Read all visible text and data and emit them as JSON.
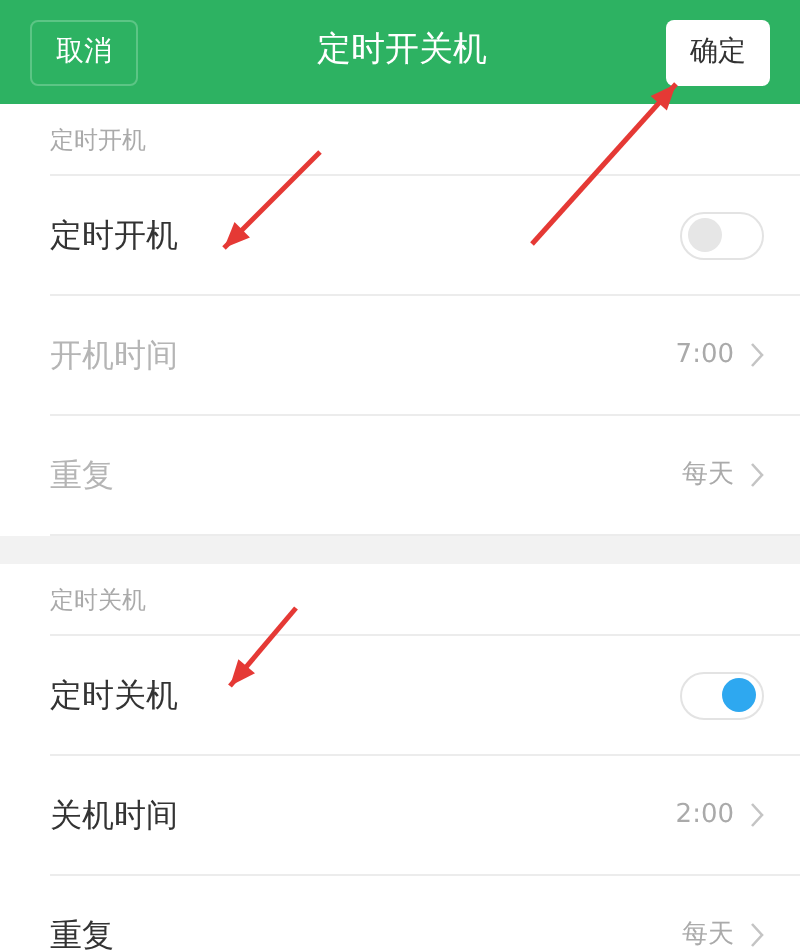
{
  "header": {
    "cancel": "取消",
    "title": "定时开关机",
    "confirm": "确定"
  },
  "sections": [
    {
      "title": "定时开机",
      "rows": [
        {
          "kind": "toggle",
          "label": "定时开机",
          "on": false,
          "disabled": false
        },
        {
          "kind": "link",
          "label": "开机时间",
          "value": "7:00",
          "disabled": true
        },
        {
          "kind": "link",
          "label": "重复",
          "value": "每天",
          "disabled": true
        }
      ]
    },
    {
      "title": "定时关机",
      "rows": [
        {
          "kind": "toggle",
          "label": "定时关机",
          "on": true,
          "disabled": false
        },
        {
          "kind": "link",
          "label": "关机时间",
          "value": "2:00",
          "disabled": false
        },
        {
          "kind": "link",
          "label": "重复",
          "value": "每天",
          "disabled": false
        }
      ]
    }
  ]
}
